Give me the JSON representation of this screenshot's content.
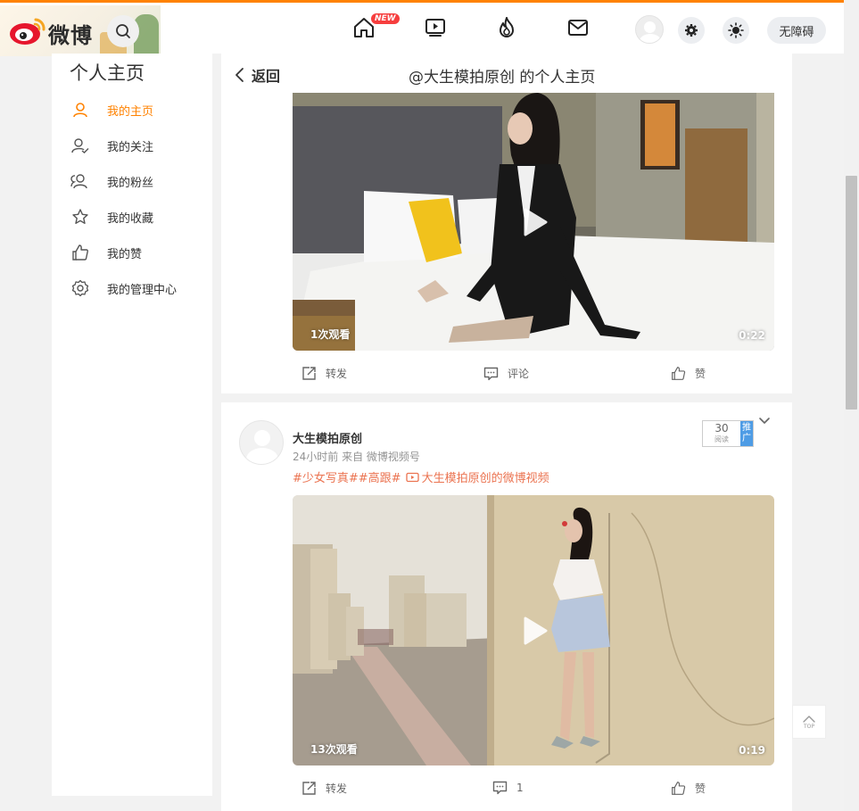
{
  "topnav": {
    "logo_text": "微博",
    "new_badge": "NEW",
    "accessibility_label": "无障碍"
  },
  "sidebar": {
    "title": "个人主页",
    "items": [
      {
        "label": "我的主页",
        "icon": "user-icon",
        "active": true
      },
      {
        "label": "我的关注",
        "icon": "user-check-icon",
        "active": false
      },
      {
        "label": "我的粉丝",
        "icon": "users-icon",
        "active": false
      },
      {
        "label": "我的收藏",
        "icon": "star-icon",
        "active": false
      },
      {
        "label": "我的赞",
        "icon": "thumbs-up-icon",
        "active": false
      },
      {
        "label": "我的管理中心",
        "icon": "gear-icon",
        "active": false
      }
    ]
  },
  "header": {
    "back_label": "返回",
    "title": "@大生模拍原创 的个人主页"
  },
  "posts": [
    {
      "video": {
        "views": "1次观看",
        "duration": "0:22"
      },
      "actions": {
        "repost": "转发",
        "comment": "评论",
        "like": "赞"
      }
    },
    {
      "author": "大生模拍原创",
      "meta": "24小时前  来自 微博视频号",
      "topics": "#少女写真##高跟#",
      "video_link": "大生模拍原创的微博视频",
      "read_count": "30",
      "read_label": "阅读",
      "promote_label": "推广",
      "video": {
        "views": "13次观看",
        "duration": "0:19"
      },
      "actions": {
        "repost": "转发",
        "comment": "1",
        "like": "赞"
      }
    }
  ],
  "totop_label": "TOP",
  "colors": {
    "accent": "#ff8200",
    "topic": "#eb7350",
    "promote": "#4e9ce5"
  }
}
